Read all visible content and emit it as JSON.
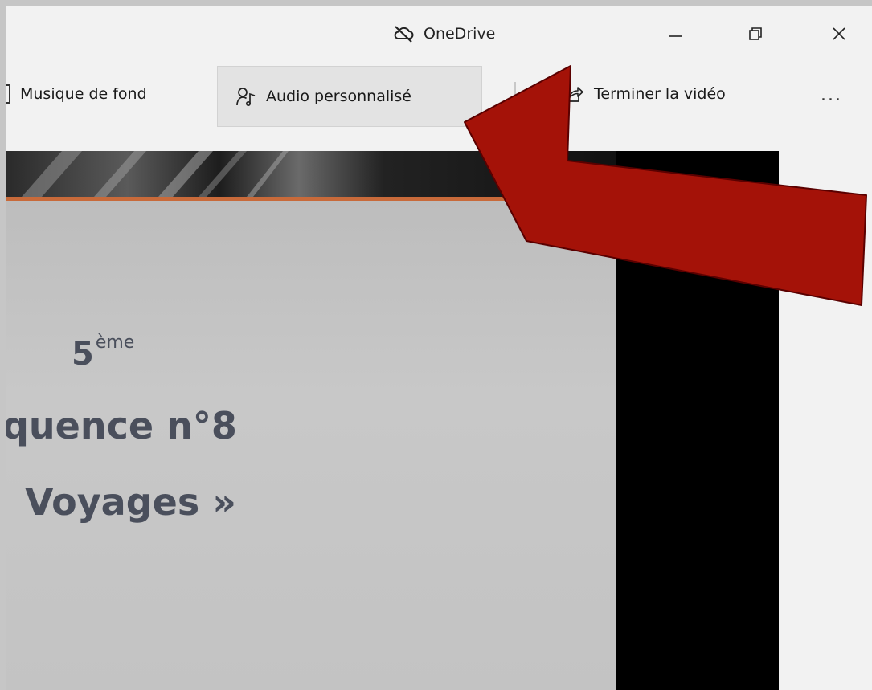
{
  "window": {
    "title": "OneDrive",
    "controls": {
      "minimize": "minimize-icon",
      "restore": "restore-icon",
      "close": "close-icon"
    }
  },
  "toolbar": {
    "music_label": "Musique de fond",
    "audio_label": "Audio personnalisé",
    "finish_label": "Terminer la vidéo",
    "more_label": "..."
  },
  "slide": {
    "grade_number": "5",
    "grade_suffix": "ème",
    "sequence_text": "quence n°8",
    "theme_text": "Voyages »"
  },
  "annotation": {
    "arrow_color": "#a41208",
    "arrow_outline": "#5a0000"
  },
  "colors": {
    "window_bg": "#f2f2f2",
    "slide_text": "#4a4f5c",
    "banner_accent": "#c86a3a"
  }
}
